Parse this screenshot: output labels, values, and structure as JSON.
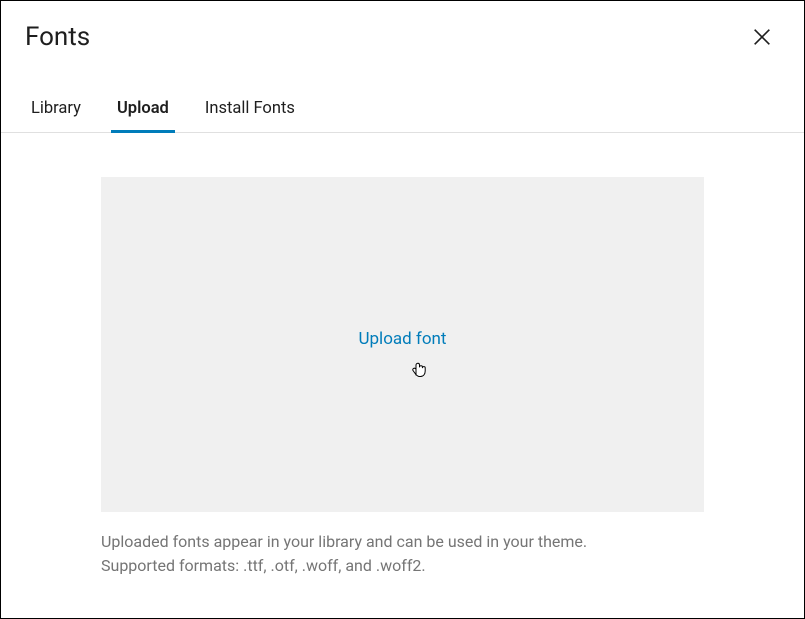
{
  "header": {
    "title": "Fonts"
  },
  "tabs": {
    "library": "Library",
    "upload": "Upload",
    "install": "Install Fonts"
  },
  "dropzone": {
    "upload_link": "Upload font"
  },
  "helper": {
    "line1": "Uploaded fonts appear in your library and can be used in your theme.",
    "line2": "Supported formats: .ttf, .otf, .woff, and .woff2."
  }
}
